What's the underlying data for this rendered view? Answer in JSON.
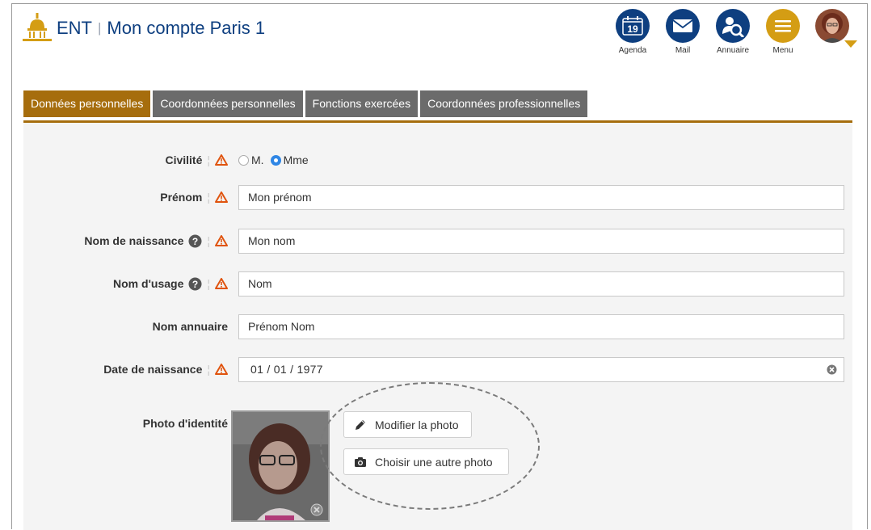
{
  "header": {
    "brand": "ENT",
    "separator": "|",
    "title": "Mon compte Paris 1",
    "icons": [
      {
        "name": "calendar-icon",
        "label": "Agenda",
        "badge": "19"
      },
      {
        "name": "mail-icon",
        "label": "Mail"
      },
      {
        "name": "directory-icon",
        "label": "Annuaire"
      },
      {
        "name": "menu-icon",
        "label": "Menu"
      }
    ]
  },
  "tabs": [
    {
      "label": "Données personnelles",
      "active": true
    },
    {
      "label": "Coordonnées personnelles",
      "active": false
    },
    {
      "label": "Fonctions exercées",
      "active": false
    },
    {
      "label": "Coordonnées professionnelles",
      "active": false
    }
  ],
  "form": {
    "civilite": {
      "label": "Civilité",
      "options": [
        "M.",
        "Mme"
      ],
      "selected": "Mme"
    },
    "prenom": {
      "label": "Prénom",
      "value": "Mon prénom"
    },
    "nom_naissance": {
      "label": "Nom de naissance",
      "value": "Mon nom"
    },
    "nom_usage": {
      "label": "Nom d'usage",
      "value": "Nom"
    },
    "nom_annuaire": {
      "label": "Nom annuaire",
      "value": "Prénom Nom"
    },
    "date_naissance": {
      "label": "Date de naissance",
      "value": "01 / 01 / 1977"
    },
    "photo": {
      "label": "Photo d'identité",
      "edit_button": "Modifier la photo",
      "choose_button": "Choisir une autre photo"
    }
  },
  "colors": {
    "brand_blue": "#0e3f80",
    "accent_gold": "#a66d0d",
    "menu_gold": "#d49d14",
    "tab_inactive": "#6b6b6b",
    "warning_orange": "#e0540f",
    "radio_blue": "#2f86e5"
  }
}
